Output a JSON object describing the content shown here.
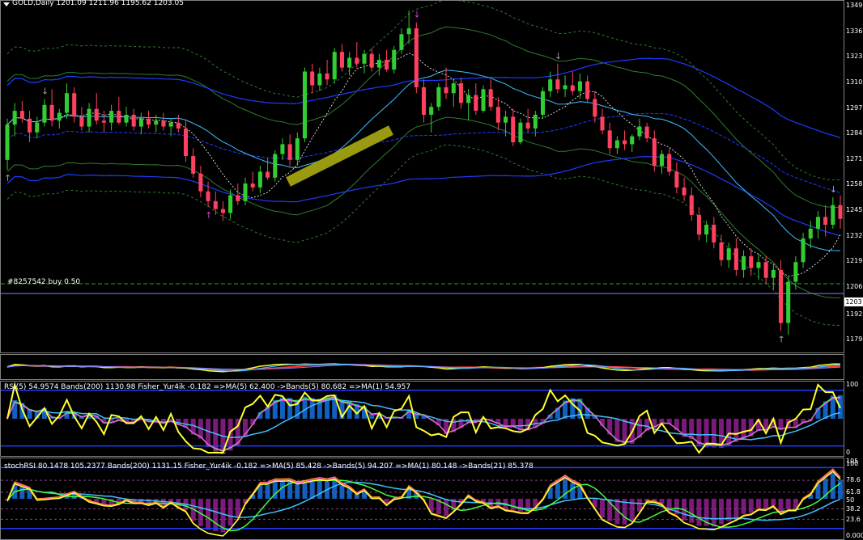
{
  "symbol_header": "GOLD,Daily  1201.09 1211.96 1195.62 1203.05",
  "order_label": "#8257542 buy 0.50",
  "price_badge": "1203",
  "indicator1_header": "RSI(5) 54.9574  Bands(200) 1130.98  Fisher_Yur4ik -0.182 =>MA(5) 62.400 ->Bands(5) 80.682 =>MA(1) 54.957",
  "indicator2_header": "stochRSI 80.1478 105.2377  Bands(200) 1131.15  Fisher_Yur4ik -0.182 =>MA(5) 85.428 ->Bands(5) 94.207 =>MA(1) 80.148 ->Bands(21) 85.378",
  "colors": {
    "bull": "#32cd32",
    "bear": "#ff4060",
    "band_blue": "#1e3cff",
    "band_green": "#2e7d2e",
    "ma_cyan": "#40c0ff",
    "rsi_yellow": "#ffff30",
    "hist_blue": "#1060c0",
    "hist_purple": "#7a1a7a",
    "highlight": "#9a9a10"
  },
  "chart_data": [
    {
      "type": "candlestick",
      "title": "GOLD,Daily",
      "ylim": [
        1173,
        1352
      ],
      "yticks": [
        "1349",
        "1336",
        "1323",
        "1310",
        "1297",
        "1284",
        "1271",
        "1258",
        "1245",
        "1232",
        "1219",
        "1206",
        "1192",
        "1179"
      ],
      "order_line_price": 1208,
      "current_price": 1203,
      "ohlc": [
        [
          1271,
          1292,
          1266,
          1289
        ],
        [
          1289,
          1300,
          1283,
          1296
        ],
        [
          1296,
          1301,
          1290,
          1292
        ],
        [
          1292,
          1296,
          1280,
          1285
        ],
        [
          1285,
          1293,
          1282,
          1290
        ],
        [
          1290,
          1302,
          1288,
          1299
        ],
        [
          1299,
          1307,
          1288,
          1291
        ],
        [
          1291,
          1297,
          1287,
          1295
        ],
        [
          1295,
          1310,
          1292,
          1305
        ],
        [
          1305,
          1308,
          1290,
          1293
        ],
        [
          1293,
          1298,
          1286,
          1288
        ],
        [
          1288,
          1300,
          1285,
          1297
        ],
        [
          1297,
          1305,
          1289,
          1291
        ],
        [
          1291,
          1296,
          1285,
          1290
        ],
        [
          1290,
          1299,
          1286,
          1296
        ],
        [
          1296,
          1303,
          1289,
          1290
        ],
        [
          1290,
          1298,
          1288,
          1294
        ],
        [
          1294,
          1297,
          1286,
          1288
        ],
        [
          1288,
          1295,
          1284,
          1292
        ],
        [
          1292,
          1296,
          1287,
          1289
        ],
        [
          1289,
          1294,
          1285,
          1291
        ],
        [
          1291,
          1295,
          1286,
          1288
        ],
        [
          1288,
          1292,
          1283,
          1290
        ],
        [
          1290,
          1294,
          1285,
          1287
        ],
        [
          1287,
          1291,
          1270,
          1273
        ],
        [
          1273,
          1277,
          1262,
          1264
        ],
        [
          1264,
          1268,
          1252,
          1255
        ],
        [
          1255,
          1260,
          1247,
          1250
        ],
        [
          1250,
          1255,
          1243,
          1246
        ],
        [
          1246,
          1250,
          1240,
          1244
        ],
        [
          1244,
          1256,
          1241,
          1253
        ],
        [
          1253,
          1259,
          1248,
          1250
        ],
        [
          1250,
          1262,
          1248,
          1259
        ],
        [
          1259,
          1265,
          1255,
          1257
        ],
        [
          1257,
          1268,
          1254,
          1265
        ],
        [
          1265,
          1272,
          1261,
          1262
        ],
        [
          1262,
          1276,
          1260,
          1274
        ],
        [
          1274,
          1282,
          1271,
          1279
        ],
        [
          1279,
          1284,
          1268,
          1271
        ],
        [
          1271,
          1285,
          1268,
          1282
        ],
        [
          1282,
          1318,
          1280,
          1316
        ],
        [
          1316,
          1320,
          1305,
          1309
        ],
        [
          1309,
          1318,
          1306,
          1315
        ],
        [
          1315,
          1322,
          1309,
          1312
        ],
        [
          1312,
          1328,
          1310,
          1326
        ],
        [
          1326,
          1330,
          1316,
          1318
        ],
        [
          1318,
          1326,
          1314,
          1323
        ],
        [
          1323,
          1331,
          1318,
          1320
        ],
        [
          1320,
          1327,
          1315,
          1325
        ],
        [
          1325,
          1328,
          1316,
          1318
        ],
        [
          1318,
          1325,
          1314,
          1322
        ],
        [
          1322,
          1327,
          1316,
          1317
        ],
        [
          1317,
          1329,
          1315,
          1327
        ],
        [
          1327,
          1338,
          1325,
          1335
        ],
        [
          1335,
          1347,
          1330,
          1338
        ],
        [
          1338,
          1341,
          1305,
          1308
        ],
        [
          1308,
          1312,
          1290,
          1294
        ],
        [
          1294,
          1300,
          1285,
          1298
        ],
        [
          1298,
          1310,
          1296,
          1308
        ],
        [
          1308,
          1318,
          1302,
          1305
        ],
        [
          1305,
          1312,
          1298,
          1310
        ],
        [
          1310,
          1313,
          1297,
          1300
        ],
        [
          1300,
          1307,
          1291,
          1304
        ],
        [
          1304,
          1310,
          1294,
          1296
        ],
        [
          1296,
          1309,
          1295,
          1307
        ],
        [
          1307,
          1312,
          1296,
          1298
        ],
        [
          1298,
          1303,
          1286,
          1290
        ],
        [
          1290,
          1296,
          1283,
          1293
        ],
        [
          1293,
          1297,
          1278,
          1280
        ],
        [
          1280,
          1292,
          1279,
          1290
        ],
        [
          1290,
          1297,
          1285,
          1287
        ],
        [
          1287,
          1296,
          1283,
          1294
        ],
        [
          1294,
          1308,
          1292,
          1306
        ],
        [
          1306,
          1316,
          1303,
          1312
        ],
        [
          1312,
          1320,
          1305,
          1307
        ],
        [
          1307,
          1314,
          1303,
          1309
        ],
        [
          1309,
          1316,
          1304,
          1306
        ],
        [
          1306,
          1315,
          1302,
          1311
        ],
        [
          1311,
          1314,
          1300,
          1302
        ],
        [
          1302,
          1306,
          1290,
          1293
        ],
        [
          1293,
          1297,
          1284,
          1286
        ],
        [
          1286,
          1290,
          1274,
          1277
        ],
        [
          1277,
          1283,
          1274,
          1281
        ],
        [
          1281,
          1286,
          1276,
          1279
        ],
        [
          1279,
          1284,
          1275,
          1283
        ],
        [
          1283,
          1292,
          1281,
          1288
        ],
        [
          1288,
          1290,
          1280,
          1282
        ],
        [
          1282,
          1286,
          1265,
          1268
        ],
        [
          1268,
          1276,
          1264,
          1274
        ],
        [
          1274,
          1277,
          1263,
          1265
        ],
        [
          1265,
          1270,
          1254,
          1257
        ],
        [
          1257,
          1262,
          1250,
          1253
        ],
        [
          1253,
          1257,
          1240,
          1243
        ],
        [
          1243,
          1247,
          1230,
          1233
        ],
        [
          1233,
          1240,
          1229,
          1238
        ],
        [
          1238,
          1242,
          1226,
          1229
        ],
        [
          1229,
          1233,
          1217,
          1220
        ],
        [
          1220,
          1229,
          1216,
          1226
        ],
        [
          1226,
          1231,
          1212,
          1215
        ],
        [
          1215,
          1225,
          1211,
          1222
        ],
        [
          1222,
          1226,
          1212,
          1216
        ],
        [
          1216,
          1223,
          1210,
          1219
        ],
        [
          1219,
          1222,
          1208,
          1211
        ],
        [
          1211,
          1218,
          1205,
          1215
        ],
        [
          1215,
          1220,
          1184,
          1188
        ],
        [
          1188,
          1212,
          1182,
          1209
        ],
        [
          1209,
          1222,
          1205,
          1219
        ],
        [
          1219,
          1234,
          1216,
          1231
        ],
        [
          1231,
          1240,
          1226,
          1236
        ],
        [
          1236,
          1245,
          1231,
          1242
        ],
        [
          1242,
          1248,
          1232,
          1238
        ],
        [
          1238,
          1252,
          1236,
          1248
        ],
        [
          1248,
          1253,
          1236,
          1241
        ]
      ]
    },
    {
      "type": "line",
      "title": "RSI(5)",
      "ylim": [
        0,
        100
      ],
      "yticks": [
        "100",
        "0"
      ]
    },
    {
      "type": "line",
      "title": "stochRSI",
      "ylim": [
        0,
        105
      ],
      "yticks": [
        "105",
        "100",
        "78.6",
        "61.8",
        "50",
        "38.2",
        "23.6",
        "0.000"
      ]
    }
  ]
}
